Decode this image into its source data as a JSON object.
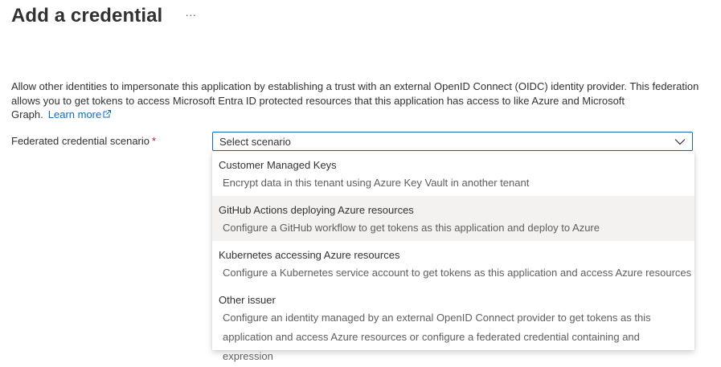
{
  "header": {
    "title": "Add a credential",
    "more_label": "···"
  },
  "description": {
    "text": "Allow other identities to impersonate this application by establishing a trust with an external OpenID Connect (OIDC) identity provider. This federation allows you to get tokens to access Microsoft Entra ID protected resources that this application has access to like Azure and Microsoft Graph.",
    "learn_more": "Learn more"
  },
  "field": {
    "label": "Federated credential scenario",
    "required_mark": "*",
    "selected_value": "Select scenario"
  },
  "dropdown": {
    "options": [
      {
        "title": "Customer Managed Keys",
        "description": "Encrypt data in this tenant using Azure Key Vault in another tenant"
      },
      {
        "title": "GitHub Actions deploying Azure resources",
        "description": "Configure a GitHub workflow to get tokens as this application and deploy to Azure"
      },
      {
        "title": "Kubernetes accessing Azure resources",
        "description": "Configure a Kubernetes service account to get tokens as this application and access Azure resources"
      },
      {
        "title": "Other issuer",
        "description": "Configure an identity managed by an external OpenID Connect provider to get tokens as this application and access Azure resources or configure a federated credential containing and expression"
      }
    ],
    "hovered_index": 1
  },
  "colors": {
    "link": "#0f6cbd",
    "required": "#a4262c",
    "focus_border": "#0f6cbd",
    "hover_bg": "#f3f2f1"
  }
}
